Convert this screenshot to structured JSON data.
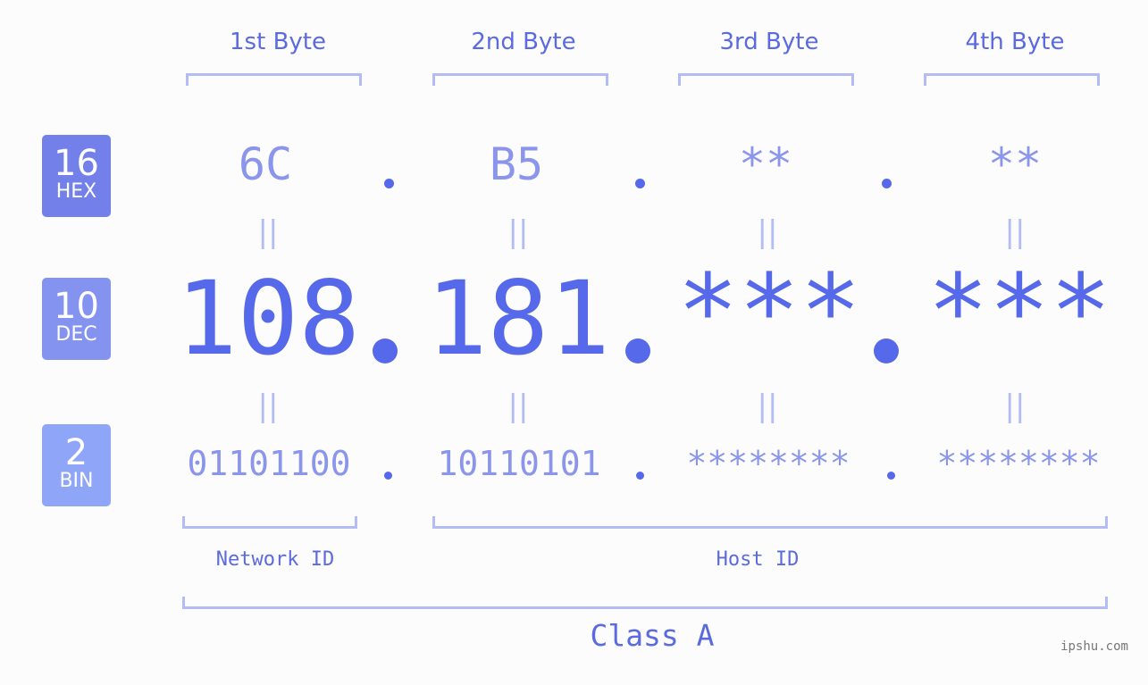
{
  "bytes": [
    {
      "label": "1st Byte",
      "hex": "6C",
      "dec": "108",
      "bin": "01101100"
    },
    {
      "label": "2nd Byte",
      "hex": "B5",
      "dec": "181",
      "bin": "10110101"
    },
    {
      "label": "3rd Byte",
      "hex": "**",
      "dec": "***",
      "bin": "********"
    },
    {
      "label": "4th Byte",
      "hex": "**",
      "dec": "***",
      "bin": "********"
    }
  ],
  "badges": {
    "hex": {
      "base": "16",
      "label": "HEX",
      "color": "#7380ea"
    },
    "dec": {
      "base": "10",
      "label": "DEC",
      "color": "#8593f0"
    },
    "bin": {
      "base": "2",
      "label": "BIN",
      "color": "#8fa6f8"
    }
  },
  "equals_glyph": "||",
  "network_id_label": "Network ID",
  "host_id_label": "Host ID",
  "class_label": "Class A",
  "watermark": "ipshu.com",
  "colors": {
    "accent": "#5669ea",
    "light": "#8a95eb",
    "bracket": "#b4bcf5"
  }
}
